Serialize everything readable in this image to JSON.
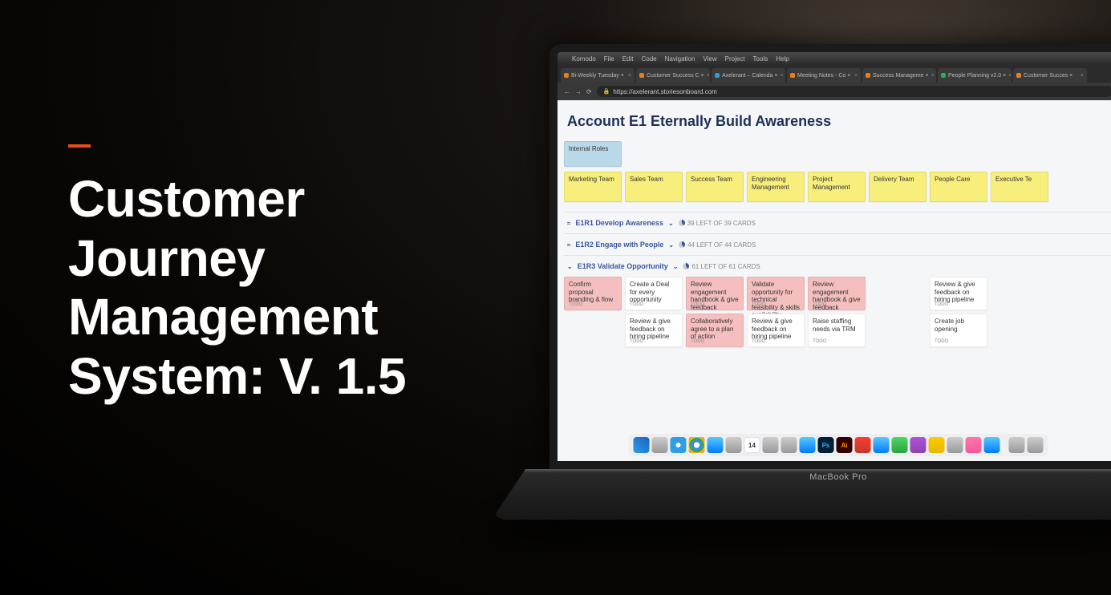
{
  "headline": "Customer Journey Management System: V. 1.5",
  "laptop_model": "MacBook Pro",
  "mac_menu": [
    "Komodo",
    "File",
    "Edit",
    "Code",
    "Navigation",
    "View",
    "Project",
    "Tools",
    "Help"
  ],
  "browser": {
    "tabs": [
      {
        "label": "Bi-Weekly Tuesday ×"
      },
      {
        "label": "Customer Success C ×"
      },
      {
        "label": "Axelerant – Calenda ×"
      },
      {
        "label": "Meeting Notes - Co ×"
      },
      {
        "label": "Success Manageme ×"
      },
      {
        "label": "People Planning v2.0 ×"
      },
      {
        "label": "Customer Succes ×"
      }
    ],
    "url": "https://axelerant.storiesonboard.com"
  },
  "board": {
    "title": "Account E1 Eternally Build Awareness",
    "role_card": "Internal Roles",
    "teams": [
      "Marketing Team",
      "Sales Team",
      "Success Team",
      "Engineering Management",
      "Project Management",
      "Delivery Team",
      "People Care",
      "Executive Te"
    ],
    "sections": [
      {
        "name": "E1R1 Develop Awareness",
        "count": "39 LEFT OF 39 CARDS",
        "expanded": false
      },
      {
        "name": "E1R2 Engage with People",
        "count": "44 LEFT OF 44 CARDS",
        "expanded": false
      },
      {
        "name": "E1R3 Validate Opportunity",
        "count": "61 LEFT OF 61 CARDS",
        "expanded": true
      }
    ],
    "task_rows": [
      [
        {
          "t": "Confirm proposal branding & flow",
          "c": "pink"
        },
        {
          "t": "Create a Deal for every opportunity",
          "c": ""
        },
        {
          "t": "Review engagement handbook & give feedback",
          "c": "pink"
        },
        {
          "t": "Validate opportunity for technical feasibility & skills availability",
          "c": "pink"
        },
        {
          "t": "Review engagement handbook & give feedback",
          "c": "pink"
        },
        {
          "t": "",
          "c": "empty"
        },
        {
          "t": "Review & give feedback on hiring pipeline",
          "c": ""
        }
      ],
      [
        {
          "t": "",
          "c": "empty"
        },
        {
          "t": "Review & give feedback on hiring pipeline",
          "c": ""
        },
        {
          "t": "Collaboratively agree to a plan of action",
          "c": "pink"
        },
        {
          "t": "Review & give feedback on hiring pipeline",
          "c": ""
        },
        {
          "t": "Raise staffing needs via TRM",
          "c": ""
        },
        {
          "t": "",
          "c": "empty"
        },
        {
          "t": "Create job opening",
          "c": ""
        }
      ]
    ],
    "todo_label": "TODO"
  },
  "dock_cal": "14",
  "dock_ps": "Ps",
  "dock_ai": "Ai"
}
